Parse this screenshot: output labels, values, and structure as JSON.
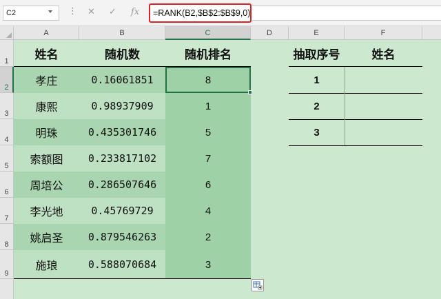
{
  "namebox": {
    "value": "C2"
  },
  "formula": {
    "text": "=RANK(B2,$B$2:$B$9,0)",
    "fx": "fx",
    "cancel": "✕",
    "enter": "✓",
    "dots": "⋮"
  },
  "columns": [
    "A",
    "B",
    "C",
    "D",
    "E",
    "F"
  ],
  "rows": [
    "1",
    "2",
    "3",
    "4",
    "5",
    "6",
    "7",
    "8",
    "9"
  ],
  "table": {
    "headers": [
      "姓名",
      "随机数",
      "随机排名"
    ],
    "rows": [
      {
        "name": "孝庄",
        "rand": "0.16061851",
        "rank": "8"
      },
      {
        "name": "康熙",
        "rand": "0.98937909",
        "rank": "1"
      },
      {
        "name": "明珠",
        "rand": "0.435301746",
        "rank": "5"
      },
      {
        "name": "索额图",
        "rand": "0.233817102",
        "rank": "7"
      },
      {
        "name": "周培公",
        "rand": "0.286507646",
        "rank": "6"
      },
      {
        "name": "李光地",
        "rand": "0.45769729",
        "rank": "4"
      },
      {
        "name": "姚启圣",
        "rand": "0.879546263",
        "rank": "2"
      },
      {
        "name": "施琅",
        "rand": "0.588070684",
        "rank": "3"
      }
    ]
  },
  "draw_table": {
    "headers": [
      "抽取序号",
      "姓名"
    ],
    "numbers": [
      "1",
      "2",
      "3"
    ]
  },
  "colors": {
    "accent": "#217346",
    "highlight": "#e02020",
    "sheet_bg": "#cce8cf",
    "band_dark": "#a9d6b0",
    "band_light": "#bfe1c3",
    "rank_col": "#9fd1a6"
  }
}
